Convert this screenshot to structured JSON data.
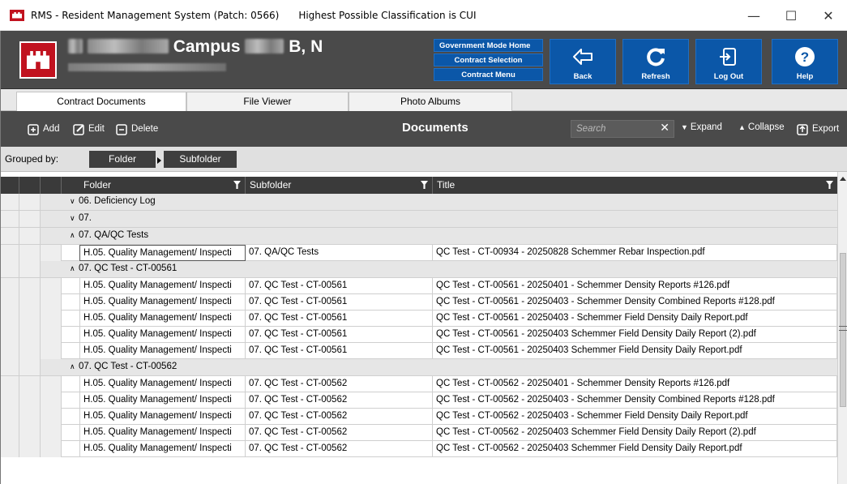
{
  "window": {
    "title": "RMS - Resident Management System (Patch: 0566)",
    "classification": "Highest Possible Classification is CUI",
    "minimize": "—",
    "maximize": "☐",
    "close": "✕"
  },
  "header": {
    "campus_label": "Campus",
    "campus_suffix": "B, N",
    "mode_links": [
      "Government Mode Home",
      "Contract Selection",
      "Contract Menu"
    ],
    "nav_buttons": [
      {
        "label": "Back",
        "icon": "back-arrow-icon"
      },
      {
        "label": "Refresh",
        "icon": "refresh-icon"
      },
      {
        "label": "Log Out",
        "icon": "logout-icon"
      },
      {
        "label": "Help",
        "icon": "help-icon"
      }
    ],
    "brand_color": "#0b57a8"
  },
  "tabs": [
    "Contract Documents",
    "File Viewer",
    "Photo Albums"
  ],
  "toolbar": {
    "add": "Add",
    "edit": "Edit",
    "delete": "Delete",
    "title": "Documents",
    "search_placeholder": "Search",
    "clear": "✕",
    "expand": "Expand",
    "collapse": "Collapse",
    "export": "Export"
  },
  "grouping": {
    "label": "Grouped by:",
    "groups": [
      "Folder",
      "Subfolder"
    ]
  },
  "columns": [
    "Folder",
    "Subfolder",
    "Title"
  ],
  "rows": [
    {
      "type": "group1",
      "state": "collapsed",
      "label": "06. Deficiency Log"
    },
    {
      "type": "group1",
      "state": "collapsed",
      "label": "07."
    },
    {
      "type": "group1",
      "state": "expanded",
      "label": "07. QA/QC Tests"
    },
    {
      "type": "data",
      "folder": "H.05. Quality Management/ Inspecti",
      "subfolder": "07. QA/QC Tests",
      "title": "QC Test - CT-00934 - 20250828 Schemmer Rebar Inspection.pdf",
      "selected": true
    },
    {
      "type": "group1",
      "state": "expanded",
      "label": "07. QC Test - CT-00561"
    },
    {
      "type": "data",
      "folder": "H.05. Quality Management/ Inspecti",
      "subfolder": "07. QC Test - CT-00561",
      "title": "QC Test - CT-00561 - 20250401 - Schemmer  Density Reports #126.pdf"
    },
    {
      "type": "data",
      "folder": "H.05. Quality Management/ Inspecti",
      "subfolder": "07. QC Test - CT-00561",
      "title": "QC Test - CT-00561 - 20250403 - Schemmer Density Combined Reports #128.pdf"
    },
    {
      "type": "data",
      "folder": "H.05. Quality Management/ Inspecti",
      "subfolder": "07. QC Test - CT-00561",
      "title": "QC Test - CT-00561 - 20250403 - Schemmer Field Density Daily Report.pdf"
    },
    {
      "type": "data",
      "folder": "H.05. Quality Management/ Inspecti",
      "subfolder": "07. QC Test - CT-00561",
      "title": "QC Test - CT-00561 - 20250403 Schemmer Field Density Daily Report (2).pdf"
    },
    {
      "type": "data",
      "folder": "H.05. Quality Management/ Inspecti",
      "subfolder": "07. QC Test - CT-00561",
      "title": "QC Test - CT-00561 - 20250403 Schemmer Field Density Daily Report.pdf"
    },
    {
      "type": "group1",
      "state": "expanded",
      "label": "07. QC Test - CT-00562"
    },
    {
      "type": "data",
      "folder": "H.05. Quality Management/ Inspecti",
      "subfolder": "07. QC Test - CT-00562",
      "title": "QC Test - CT-00562 - 20250401 - Schemmer  Density Reports #126.pdf"
    },
    {
      "type": "data",
      "folder": "H.05. Quality Management/ Inspecti",
      "subfolder": "07. QC Test - CT-00562",
      "title": "QC Test - CT-00562 - 20250403 - Schemmer Density Combined Reports #128.pdf"
    },
    {
      "type": "data",
      "folder": "H.05. Quality Management/ Inspecti",
      "subfolder": "07. QC Test - CT-00562",
      "title": "QC Test - CT-00562 - 20250403 - Schemmer Field Density Daily Report.pdf"
    },
    {
      "type": "data",
      "folder": "H.05. Quality Management/ Inspecti",
      "subfolder": "07. QC Test - CT-00562",
      "title": "QC Test - CT-00562 - 20250403 Schemmer Field Density Daily Report (2).pdf"
    },
    {
      "type": "data",
      "folder": "H.05. Quality Management/ Inspecti",
      "subfolder": "07. QC Test - CT-00562",
      "title": "QC Test - CT-00562 - 20250403 Schemmer Field Density Daily Report.pdf"
    }
  ]
}
